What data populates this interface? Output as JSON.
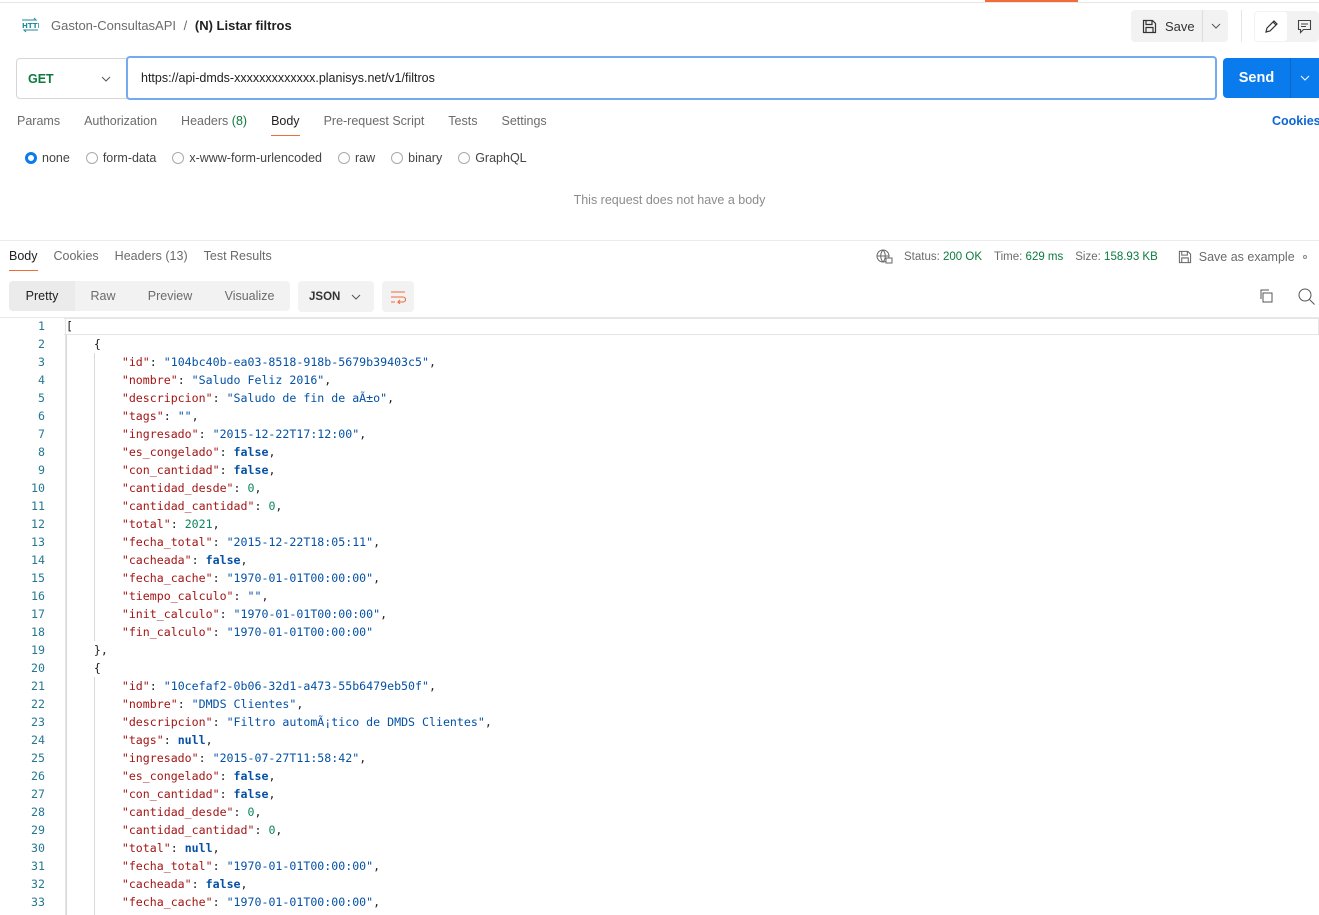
{
  "header": {
    "collection": "Gaston-ConsultasAPI",
    "separator": "/",
    "request_name": "(N) Listar filtros",
    "save_label": "Save",
    "http_icon": "http-icon"
  },
  "request": {
    "method": "GET",
    "url": "https://api-dmds-xxxxxxxxxxxxx.planisys.net/v1/filtros",
    "send_label": "Send",
    "tabs": [
      {
        "label": "Params"
      },
      {
        "label": "Authorization"
      },
      {
        "label": "Headers",
        "count": "(8)"
      },
      {
        "label": "Body",
        "active": true
      },
      {
        "label": "Pre-request Script"
      },
      {
        "label": "Tests"
      },
      {
        "label": "Settings"
      }
    ],
    "cookies_label": "Cookies",
    "body_types": [
      {
        "label": "none",
        "selected": true
      },
      {
        "label": "form-data"
      },
      {
        "label": "x-www-form-urlencoded"
      },
      {
        "label": "raw"
      },
      {
        "label": "binary"
      },
      {
        "label": "GraphQL"
      }
    ],
    "no_body_text": "This request does not have a body"
  },
  "response": {
    "tabs": [
      {
        "label": "Body",
        "active": true
      },
      {
        "label": "Cookies"
      },
      {
        "label": "Headers (13)"
      },
      {
        "label": "Test Results"
      }
    ],
    "status_label": "Status:",
    "status": "200 OK",
    "time_label": "Time:",
    "time": "629 ms",
    "size_label": "Size:",
    "size": "158.93 KB",
    "save_example": "Save as example",
    "views": [
      "Pretty",
      "Raw",
      "Preview",
      "Visualize"
    ],
    "active_view": "Pretty",
    "format": "JSON",
    "lines": [
      {
        "i": 0,
        "t": [
          [
            "p",
            "["
          ]
        ]
      },
      {
        "i": 1,
        "t": [
          [
            "p",
            "{"
          ]
        ]
      },
      {
        "i": 2,
        "t": [
          [
            "k",
            "\"id\""
          ],
          [
            "p",
            ": "
          ],
          [
            "s",
            "\"104bc40b-ea03-8518-918b-5679b39403c5\""
          ],
          [
            "p",
            ","
          ]
        ]
      },
      {
        "i": 2,
        "t": [
          [
            "k",
            "\"nombre\""
          ],
          [
            "p",
            ": "
          ],
          [
            "s",
            "\"Saludo Feliz 2016\""
          ],
          [
            "p",
            ","
          ]
        ]
      },
      {
        "i": 2,
        "t": [
          [
            "k",
            "\"descripcion\""
          ],
          [
            "p",
            ": "
          ],
          [
            "s",
            "\"Saludo de fin de aÃ±o\""
          ],
          [
            "p",
            ","
          ]
        ]
      },
      {
        "i": 2,
        "t": [
          [
            "k",
            "\"tags\""
          ],
          [
            "p",
            ": "
          ],
          [
            "s",
            "\"\""
          ],
          [
            "p",
            ","
          ]
        ]
      },
      {
        "i": 2,
        "t": [
          [
            "k",
            "\"ingresado\""
          ],
          [
            "p",
            ": "
          ],
          [
            "s",
            "\"2015-12-22T17:12:00\""
          ],
          [
            "p",
            ","
          ]
        ]
      },
      {
        "i": 2,
        "t": [
          [
            "k",
            "\"es_congelado\""
          ],
          [
            "p",
            ": "
          ],
          [
            "b",
            "false"
          ],
          [
            "p",
            ","
          ]
        ]
      },
      {
        "i": 2,
        "t": [
          [
            "k",
            "\"con_cantidad\""
          ],
          [
            "p",
            ": "
          ],
          [
            "b",
            "false"
          ],
          [
            "p",
            ","
          ]
        ]
      },
      {
        "i": 2,
        "t": [
          [
            "k",
            "\"cantidad_desde\""
          ],
          [
            "p",
            ": "
          ],
          [
            "n",
            "0"
          ],
          [
            "p",
            ","
          ]
        ]
      },
      {
        "i": 2,
        "t": [
          [
            "k",
            "\"cantidad_cantidad\""
          ],
          [
            "p",
            ": "
          ],
          [
            "n",
            "0"
          ],
          [
            "p",
            ","
          ]
        ]
      },
      {
        "i": 2,
        "t": [
          [
            "k",
            "\"total\""
          ],
          [
            "p",
            ": "
          ],
          [
            "n",
            "2021"
          ],
          [
            "p",
            ","
          ]
        ]
      },
      {
        "i": 2,
        "t": [
          [
            "k",
            "\"fecha_total\""
          ],
          [
            "p",
            ": "
          ],
          [
            "s",
            "\"2015-12-22T18:05:11\""
          ],
          [
            "p",
            ","
          ]
        ]
      },
      {
        "i": 2,
        "t": [
          [
            "k",
            "\"cacheada\""
          ],
          [
            "p",
            ": "
          ],
          [
            "b",
            "false"
          ],
          [
            "p",
            ","
          ]
        ]
      },
      {
        "i": 2,
        "t": [
          [
            "k",
            "\"fecha_cache\""
          ],
          [
            "p",
            ": "
          ],
          [
            "s",
            "\"1970-01-01T00:00:00\""
          ],
          [
            "p",
            ","
          ]
        ]
      },
      {
        "i": 2,
        "t": [
          [
            "k",
            "\"tiempo_calculo\""
          ],
          [
            "p",
            ": "
          ],
          [
            "s",
            "\"\""
          ],
          [
            "p",
            ","
          ]
        ]
      },
      {
        "i": 2,
        "t": [
          [
            "k",
            "\"init_calculo\""
          ],
          [
            "p",
            ": "
          ],
          [
            "s",
            "\"1970-01-01T00:00:00\""
          ],
          [
            "p",
            ","
          ]
        ]
      },
      {
        "i": 2,
        "t": [
          [
            "k",
            "\"fin_calculo\""
          ],
          [
            "p",
            ": "
          ],
          [
            "s",
            "\"1970-01-01T00:00:00\""
          ]
        ]
      },
      {
        "i": 1,
        "t": [
          [
            "p",
            "},"
          ]
        ]
      },
      {
        "i": 1,
        "t": [
          [
            "p",
            "{"
          ]
        ]
      },
      {
        "i": 2,
        "t": [
          [
            "k",
            "\"id\""
          ],
          [
            "p",
            ": "
          ],
          [
            "s",
            "\"10cefaf2-0b06-32d1-a473-55b6479eb50f\""
          ],
          [
            "p",
            ","
          ]
        ]
      },
      {
        "i": 2,
        "t": [
          [
            "k",
            "\"nombre\""
          ],
          [
            "p",
            ": "
          ],
          [
            "s",
            "\"DMDS Clientes\""
          ],
          [
            "p",
            ","
          ]
        ]
      },
      {
        "i": 2,
        "t": [
          [
            "k",
            "\"descripcion\""
          ],
          [
            "p",
            ": "
          ],
          [
            "s",
            "\"Filtro automÃ¡tico de DMDS Clientes\""
          ],
          [
            "p",
            ","
          ]
        ]
      },
      {
        "i": 2,
        "t": [
          [
            "k",
            "\"tags\""
          ],
          [
            "p",
            ": "
          ],
          [
            "b",
            "null"
          ],
          [
            "p",
            ","
          ]
        ]
      },
      {
        "i": 2,
        "t": [
          [
            "k",
            "\"ingresado\""
          ],
          [
            "p",
            ": "
          ],
          [
            "s",
            "\"2015-07-27T11:58:42\""
          ],
          [
            "p",
            ","
          ]
        ]
      },
      {
        "i": 2,
        "t": [
          [
            "k",
            "\"es_congelado\""
          ],
          [
            "p",
            ": "
          ],
          [
            "b",
            "false"
          ],
          [
            "p",
            ","
          ]
        ]
      },
      {
        "i": 2,
        "t": [
          [
            "k",
            "\"con_cantidad\""
          ],
          [
            "p",
            ": "
          ],
          [
            "b",
            "false"
          ],
          [
            "p",
            ","
          ]
        ]
      },
      {
        "i": 2,
        "t": [
          [
            "k",
            "\"cantidad_desde\""
          ],
          [
            "p",
            ": "
          ],
          [
            "n",
            "0"
          ],
          [
            "p",
            ","
          ]
        ]
      },
      {
        "i": 2,
        "t": [
          [
            "k",
            "\"cantidad_cantidad\""
          ],
          [
            "p",
            ": "
          ],
          [
            "n",
            "0"
          ],
          [
            "p",
            ","
          ]
        ]
      },
      {
        "i": 2,
        "t": [
          [
            "k",
            "\"total\""
          ],
          [
            "p",
            ": "
          ],
          [
            "b",
            "null"
          ],
          [
            "p",
            ","
          ]
        ]
      },
      {
        "i": 2,
        "t": [
          [
            "k",
            "\"fecha_total\""
          ],
          [
            "p",
            ": "
          ],
          [
            "s",
            "\"1970-01-01T00:00:00\""
          ],
          [
            "p",
            ","
          ]
        ]
      },
      {
        "i": 2,
        "t": [
          [
            "k",
            "\"cacheada\""
          ],
          [
            "p",
            ": "
          ],
          [
            "b",
            "false"
          ],
          [
            "p",
            ","
          ]
        ]
      },
      {
        "i": 2,
        "t": [
          [
            "k",
            "\"fecha_cache\""
          ],
          [
            "p",
            ": "
          ],
          [
            "s",
            "\"1970-01-01T00:00:00\""
          ],
          [
            "p",
            ","
          ]
        ]
      }
    ]
  },
  "colors": {
    "accent": "#f26b3a",
    "send": "#097bed",
    "status_green": "#0c7a3e",
    "json_key": "#a31515",
    "json_string": "#0451a5",
    "json_number": "#098658"
  }
}
